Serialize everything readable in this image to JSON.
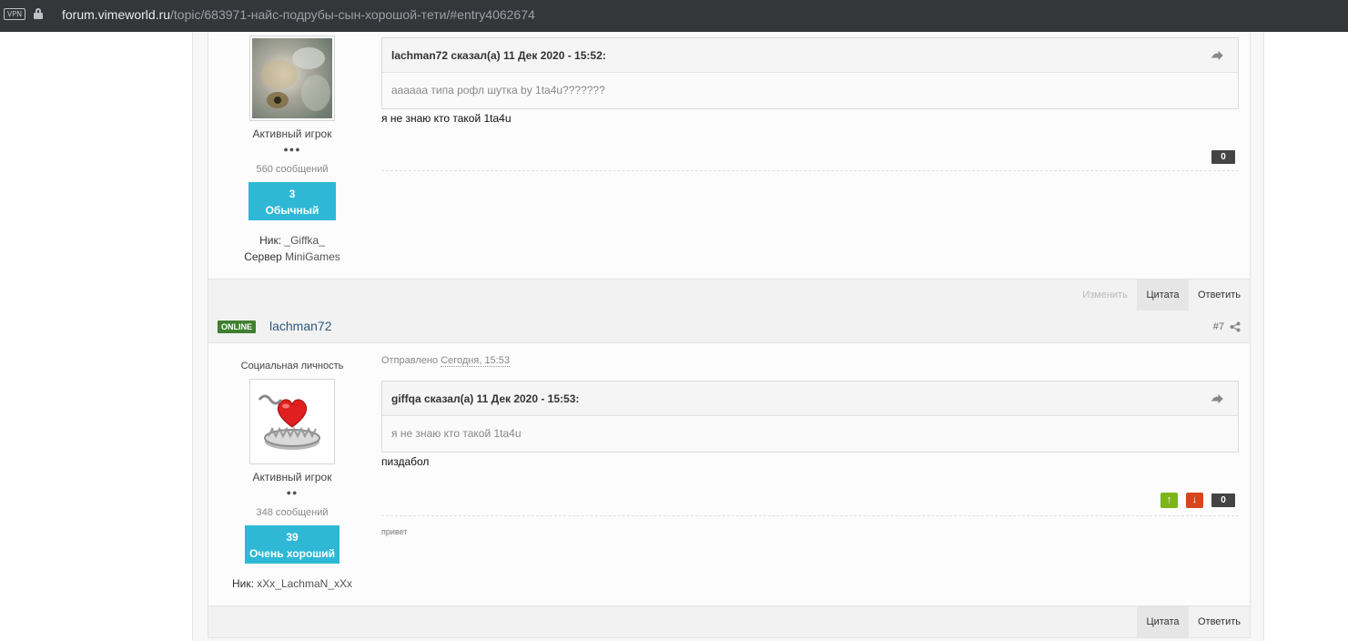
{
  "browser": {
    "vpn_label": "VPN",
    "url_host": "forum.vimeworld.ru",
    "url_path": "/topic/683971-найс-подрубы-сын-хорошой-тети/#entry4062674"
  },
  "post1": {
    "rank": "Активный игрок",
    "pips": "●●●",
    "messages": "560 сообщений",
    "rep_value": "3",
    "rep_label": "Обычный",
    "nick_label": "Ник: ",
    "nick_value": "_Giffka_",
    "server_label": "Сервер ",
    "server_value": "MiniGames",
    "quote_header": "lachman72 сказал(а) 11 Дек 2020 - 15:52:",
    "quote_body": "аааааа типа рофл шутка by 1ta4u???????",
    "body": "я не знаю кто такой 1ta4u",
    "score": "0",
    "actions": {
      "edit": "Изменить",
      "quote": "Цитата",
      "reply": "Ответить"
    }
  },
  "post2": {
    "online_badge": "ONLINE",
    "username": "lachman72",
    "post_number": "#7",
    "title": "Социальная личность",
    "sent_prefix": "Отправлено ",
    "sent_time": "Сегодня, 15:53",
    "rank": "Активный игрок",
    "pips": "●●",
    "messages": "348 сообщений",
    "rep_value": "39",
    "rep_label": "Очень хороший",
    "nick_label": "Ник: ",
    "nick_value": "xXx_LachmaN_xXx",
    "quote_header": "giffqa сказал(а) 11 Дек 2020 - 15:53:",
    "quote_body": "я не знаю кто такой 1ta4u",
    "body": "пиздабол",
    "vote_up": "↑",
    "vote_down": "↓",
    "score": "0",
    "signature": "привет",
    "actions": {
      "quote": "Цитата",
      "reply": "Ответить"
    }
  },
  "colors": {
    "accent": "#2eb8d5",
    "online": "#3f7f2f",
    "vote_up": "#7cb518",
    "vote_down": "#d9441c"
  }
}
